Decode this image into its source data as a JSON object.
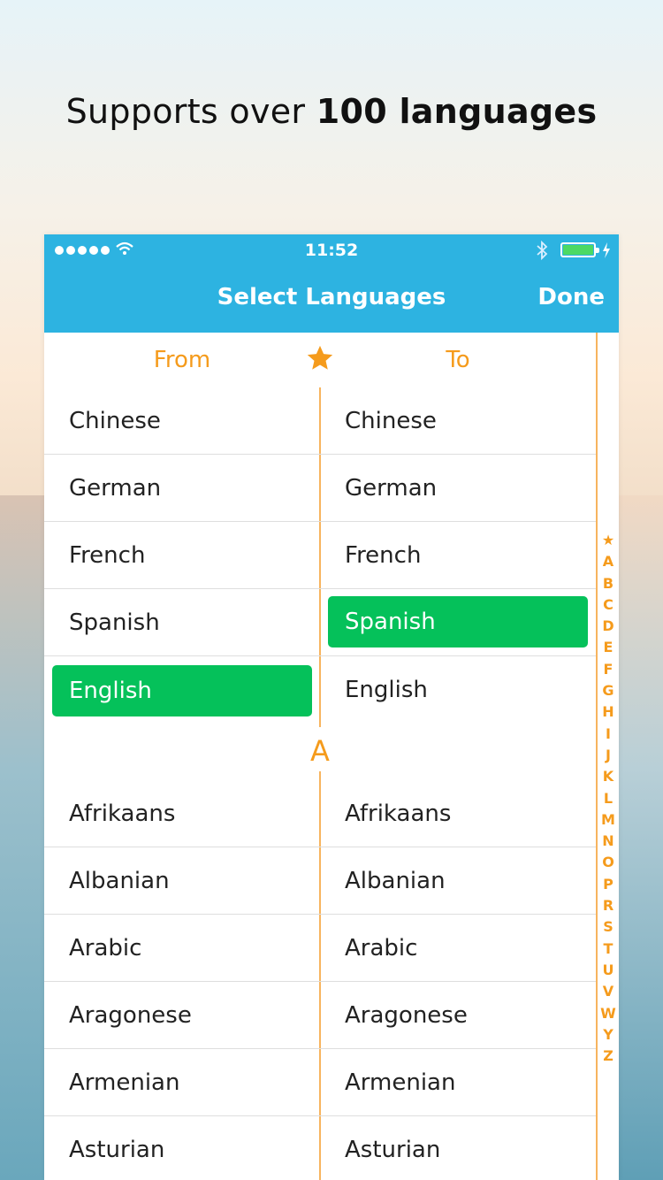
{
  "headline": {
    "prefix": "Supports over ",
    "bold": "100 languages"
  },
  "status": {
    "time": "11:52"
  },
  "nav": {
    "title": "Select Languages",
    "done": "Done"
  },
  "columns": {
    "from": "From",
    "to": "To"
  },
  "favorites": [
    {
      "left": "Chinese",
      "right": "Chinese",
      "selected": ""
    },
    {
      "left": "German",
      "right": "German",
      "selected": ""
    },
    {
      "left": "French",
      "right": "French",
      "selected": ""
    },
    {
      "left": "Spanish",
      "right": "Spanish",
      "selected": "right"
    },
    {
      "left": "English",
      "right": "English",
      "selected": "left"
    }
  ],
  "section_a": {
    "letter": "A"
  },
  "languages": [
    {
      "left": "Afrikaans",
      "right": "Afrikaans"
    },
    {
      "left": "Albanian",
      "right": "Albanian"
    },
    {
      "left": "Arabic",
      "right": "Arabic"
    },
    {
      "left": "Aragonese",
      "right": "Aragonese"
    },
    {
      "left": "Armenian",
      "right": "Armenian"
    },
    {
      "left": "Asturian",
      "right": "Asturian"
    }
  ],
  "index_letters": [
    "★",
    "A",
    "B",
    "C",
    "D",
    "E",
    "F",
    "G",
    "H",
    "I",
    "J",
    "K",
    "L",
    "M",
    "N",
    "O",
    "P",
    "R",
    "S",
    "T",
    "U",
    "V",
    "W",
    "Y",
    "Z"
  ],
  "colors": {
    "accent": "#2db3e1",
    "orange": "#f59b1c",
    "selected": "#05c15a"
  },
  "icons": {
    "favorite": "star-icon",
    "wifi": "wifi-icon",
    "bluetooth": "bluetooth-icon",
    "battery": "battery-icon",
    "charging": "bolt-icon"
  }
}
